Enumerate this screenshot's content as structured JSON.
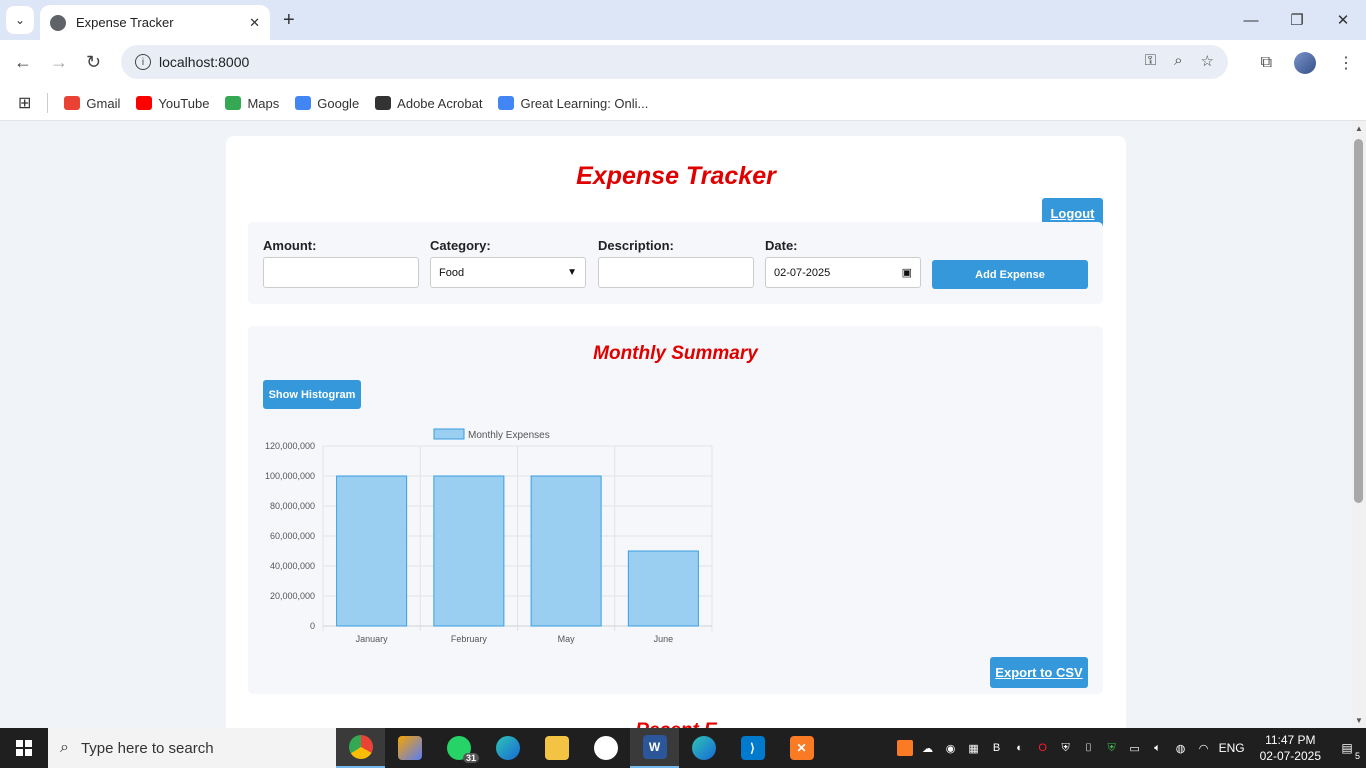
{
  "browser": {
    "tab_title": "Expense Tracker",
    "url": "localhost:8000",
    "bookmarks": [
      {
        "label": "Gmail",
        "color": "#ea4335"
      },
      {
        "label": "YouTube",
        "color": "#ff0000"
      },
      {
        "label": "Maps",
        "color": "#34a853"
      },
      {
        "label": "Google",
        "color": "#4285f4"
      },
      {
        "label": "Adobe Acrobat",
        "color": "#333333"
      },
      {
        "label": "Great Learning: Onli...",
        "color": "#4285f4"
      }
    ]
  },
  "page": {
    "title": "Expense Tracker",
    "logout_label": "Logout",
    "form": {
      "amount_label": "Amount:",
      "amount_value": "",
      "category_label": "Category:",
      "category_value": "Food",
      "description_label": "Description:",
      "description_value": "",
      "date_label": "Date:",
      "date_value": "02-07-2025",
      "add_label": "Add Expense"
    },
    "summary": {
      "title": "Monthly Summary",
      "histogram_label": "Show Histogram",
      "export_label": "Export to CSV"
    },
    "next_heading": "Recent E"
  },
  "chart_data": {
    "type": "bar",
    "categories": [
      "January",
      "February",
      "May",
      "June"
    ],
    "series": [
      {
        "name": "Monthly Expenses",
        "values": [
          100000000,
          100000000,
          100000000,
          50000000
        ]
      }
    ],
    "yticks": [
      "0",
      "20,000,000",
      "40,000,000",
      "60,000,000",
      "80,000,000",
      "100,000,000",
      "120,000,000"
    ],
    "ylim": [
      0,
      120000000
    ],
    "bar_color": "#9acff2",
    "bar_border": "#3b9ee0",
    "grid": true,
    "legend": "top"
  },
  "taskbar": {
    "search_placeholder": "Type here to search",
    "whatsapp_badge": "31",
    "language": "ENG",
    "time": "11:47 PM",
    "date": "02-07-2025",
    "notification_count": "5"
  }
}
